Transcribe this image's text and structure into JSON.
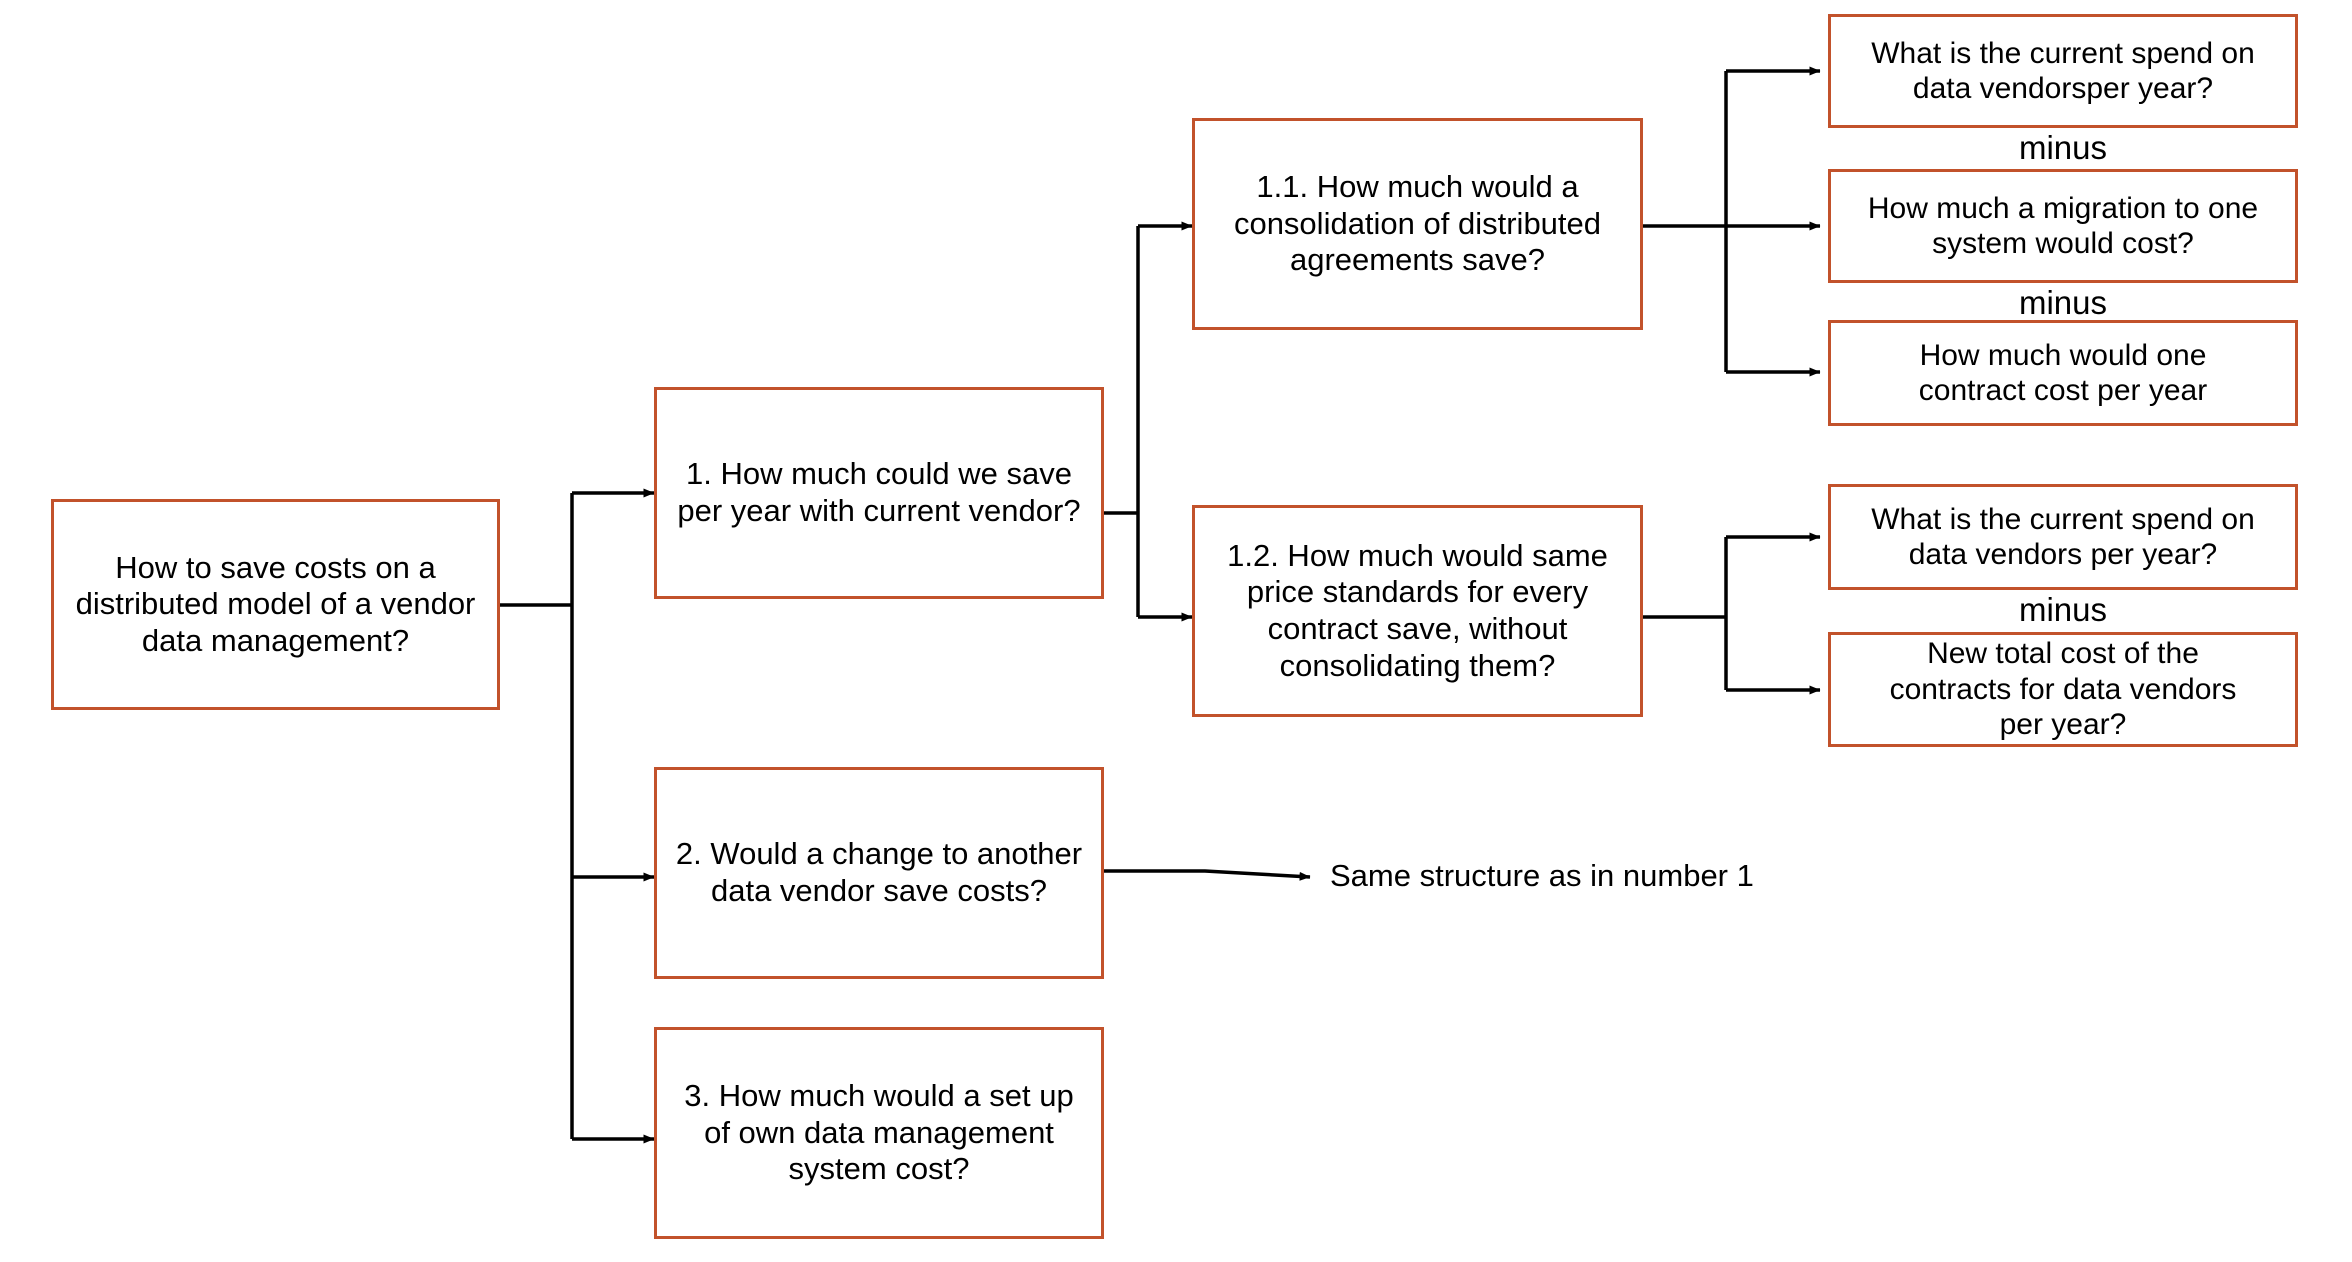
{
  "diagram": {
    "title": "How to save costs on a distributed model of a vendor data management?",
    "accent_color": "#C2522B",
    "line_color": "#000000",
    "background_color": "#FFFFFF",
    "type": "issue-tree"
  },
  "root": {
    "label": "How to save costs on a\ndistributed model of a vendor\ndata management?"
  },
  "level2": [
    {
      "label": "1. How much could we save\nper year with current vendor?"
    },
    {
      "label": "2. Would a change to another\ndata vendor save costs?"
    },
    {
      "label": "3. How much would a set up\nof own data management\nsystem cost?"
    }
  ],
  "level3": [
    {
      "label": "1.1. How much would a\nconsolidation of distributed\nagreements save?"
    },
    {
      "label": "1.2. How much would same\nprice standards for every\ncontract save, without\nconsolidating them?"
    }
  ],
  "leaves_branch_1_1": [
    {
      "label": "What is the current spend on\ndata vendorsper year?"
    },
    {
      "label": "How much a migration to one\nsystem would cost?"
    },
    {
      "label": "How much would one\ncontract cost per year"
    }
  ],
  "leaves_branch_1_2": [
    {
      "label": "What is the current spend on\ndata vendors per year?"
    },
    {
      "label": "New total cost of the\ncontracts for data vendors\nper year?"
    }
  ],
  "operators": {
    "minus_1": "minus",
    "minus_2": "minus",
    "minus_3": "minus"
  },
  "annotations": {
    "same_structure_note": "Same structure as in number 1"
  }
}
